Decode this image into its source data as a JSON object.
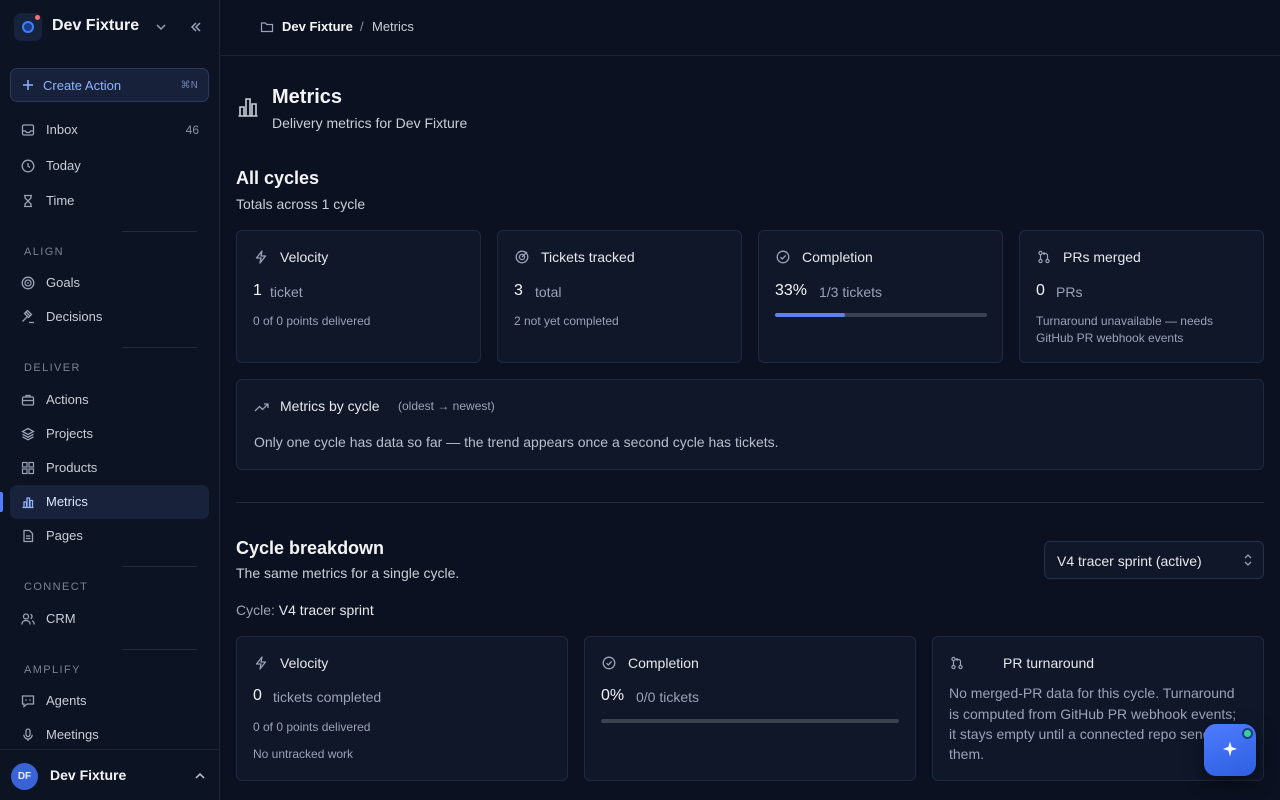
{
  "workspace": {
    "name": "Dev Fixture"
  },
  "sidebar": {
    "create": {
      "label": "Create Action",
      "shortcut": "⌘N"
    },
    "top_items": [
      {
        "label": "Inbox",
        "count": "46",
        "icon": "inbox-icon"
      },
      {
        "label": "Today",
        "icon": "clock-icon"
      },
      {
        "label": "Time",
        "icon": "hourglass-icon"
      }
    ],
    "sections": {
      "align": "ALIGN",
      "deliver": "DELIVER",
      "connect": "CONNECT",
      "amplify": "AMPLIFY"
    },
    "align_items": [
      {
        "label": "Goals",
        "icon": "target-icon"
      },
      {
        "label": "Decisions",
        "icon": "gavel-icon"
      }
    ],
    "deliver_items": [
      {
        "label": "Actions",
        "icon": "briefcase-icon"
      },
      {
        "label": "Projects",
        "icon": "layers-icon"
      },
      {
        "label": "Products",
        "icon": "grid-icon"
      },
      {
        "label": "Metrics",
        "icon": "bar-chart-icon",
        "active": true
      },
      {
        "label": "Pages",
        "icon": "document-icon"
      }
    ],
    "connect_items": [
      {
        "label": "CRM",
        "icon": "users-icon"
      }
    ],
    "amplify_items": [
      {
        "label": "Agents",
        "icon": "chat-bot-icon"
      },
      {
        "label": "Meetings",
        "icon": "microphone-icon"
      }
    ],
    "user": {
      "initials": "DF",
      "name": "Dev Fixture"
    }
  },
  "breadcrumb": {
    "workspace": "Dev Fixture",
    "separator": "/",
    "current": "Metrics"
  },
  "page": {
    "title": "Metrics",
    "subtitle": "Delivery metrics for Dev Fixture"
  },
  "all_cycles": {
    "title": "All cycles",
    "subtitle": "Totals across 1 cycle",
    "cards": {
      "velocity": {
        "title": "Velocity",
        "value": "1",
        "unit": "ticket",
        "note": "0 of 0 points delivered"
      },
      "tickets": {
        "title": "Tickets tracked",
        "value": "3",
        "unit": "total",
        "note": "2 not yet completed"
      },
      "completion": {
        "title": "Completion",
        "value": "33%",
        "unit": "1/3 tickets",
        "progress": 0.33
      },
      "prs": {
        "title": "PRs merged",
        "value": "0",
        "unit": "PRs",
        "note_line1": "Turnaround unavailable — needs",
        "note_line2": "GitHub PR webhook events"
      }
    },
    "trend": {
      "title": "Metrics by cycle",
      "hint": "(oldest → newest)",
      "message": "Only one cycle has data so far — the trend appears once a second cycle has tickets."
    }
  },
  "cycle_breakdown": {
    "title": "Cycle breakdown",
    "subtitle": "The same metrics for a single cycle.",
    "cycle_label": "Cycle:",
    "cycle_name": "V4 tracer sprint",
    "select_value": "V4 tracer sprint (active)",
    "cards": {
      "velocity": {
        "title": "Velocity",
        "value": "0",
        "unit": "tickets completed",
        "note1": "0 of 0 points delivered",
        "note2": "No untracked work"
      },
      "completion": {
        "title": "Completion",
        "value": "0%",
        "unit": "0/0 tickets",
        "progress": 0
      },
      "turnaround": {
        "title": "PR turnaround",
        "line1": "No merged-PR data for this cycle. Turnaround",
        "line2": "is computed from GitHub PR webhook events;",
        "line3": "it stays empty until a connected repo sends",
        "line4": "them."
      }
    }
  },
  "colors": {
    "accent": "#4f7fff",
    "background": "#0b1120",
    "card": "#0f1729"
  }
}
